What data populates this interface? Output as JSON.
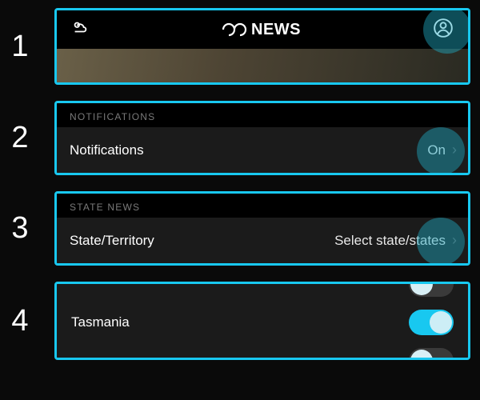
{
  "steps": [
    "1",
    "2",
    "3",
    "4"
  ],
  "header": {
    "brand_text": "NEWS"
  },
  "notifications": {
    "section": "NOTIFICATIONS",
    "label": "Notifications",
    "value": "On"
  },
  "state_news": {
    "section": "STATE NEWS",
    "label": "State/Territory",
    "value": "Select state/states"
  },
  "states": {
    "tasmania": "Tasmania",
    "tasmania_on": true
  }
}
